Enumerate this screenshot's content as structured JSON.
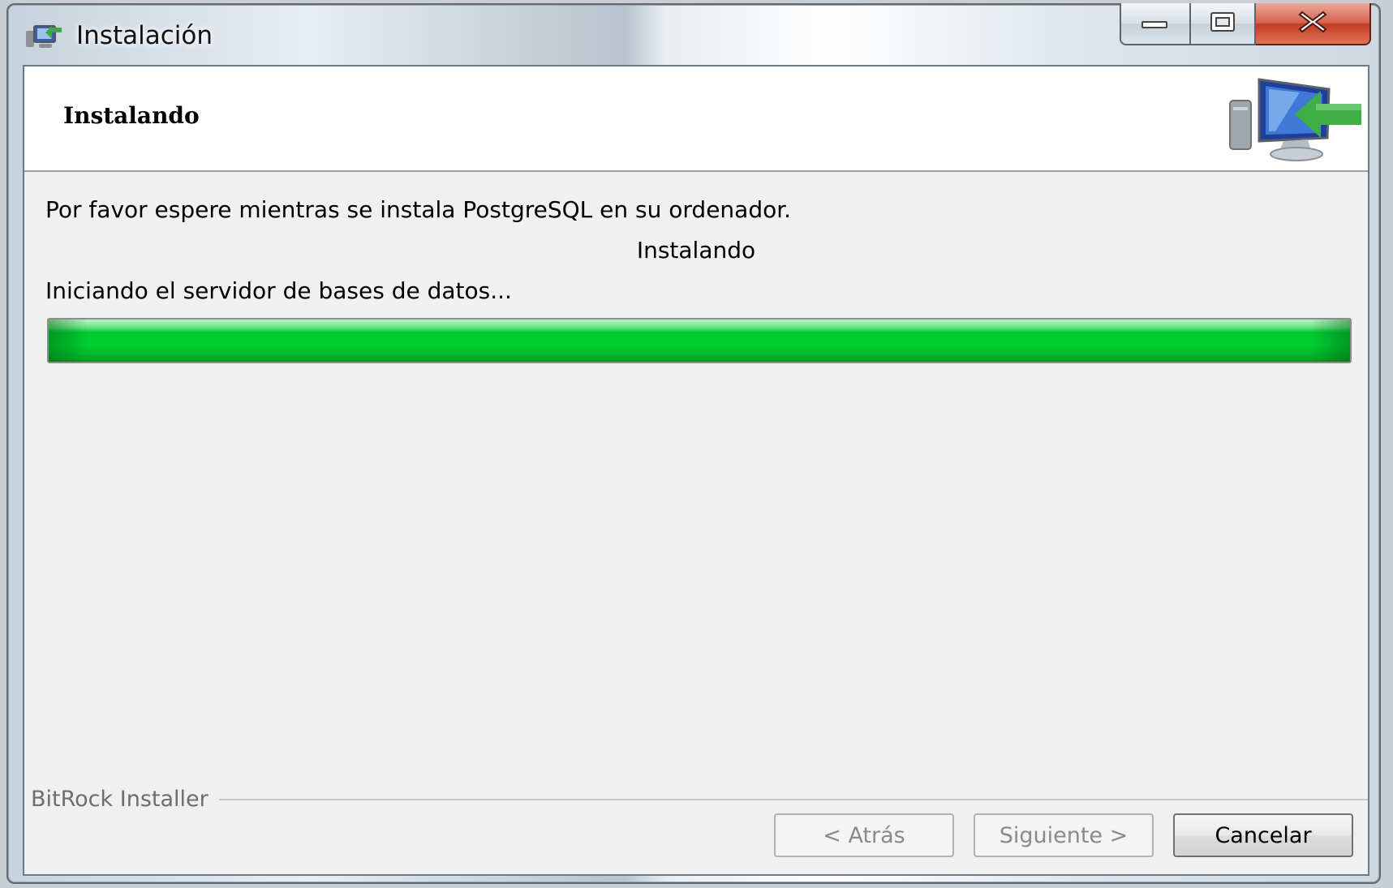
{
  "window": {
    "title": "Instalación",
    "icons": {
      "app": "installer-app-icon",
      "minimize": "minimize-icon",
      "maximize": "maximize-icon",
      "close": "close-icon"
    }
  },
  "header": {
    "title": "Instalando",
    "icon": "computer-install-arrow-icon"
  },
  "body": {
    "message": "Por favor espere mientras se instala PostgreSQL en su ordenador.",
    "status": "Instalando",
    "step": "Iniciando el servidor de bases de datos...",
    "progress": 1.0,
    "progress_color": "#00c832"
  },
  "footer": {
    "brand": "BitRock Installer",
    "back_label": "< Atrás",
    "next_label": "Siguiente >",
    "cancel_label": "Cancelar"
  }
}
